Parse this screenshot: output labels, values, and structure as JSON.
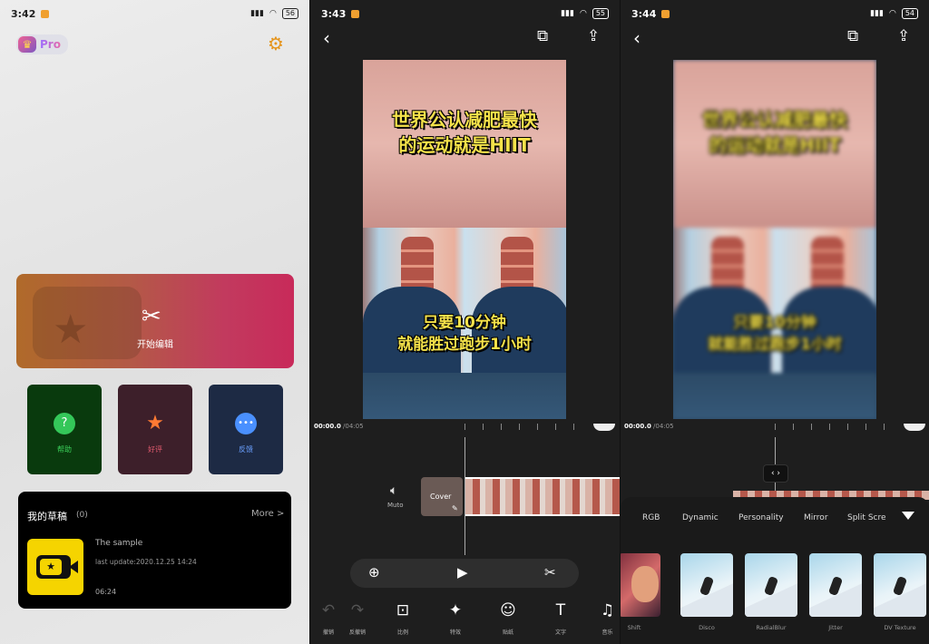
{
  "screen1": {
    "status": {
      "time": "3:42",
      "battery": "56"
    },
    "pro": "Pro",
    "start": {
      "label": "开始编辑"
    },
    "tiles": [
      {
        "label": "帮助",
        "icon": "question-icon"
      },
      {
        "label": "好评",
        "icon": "star-face-icon"
      },
      {
        "label": "反馈",
        "icon": "chat-bubble-icon"
      }
    ],
    "drafts": {
      "title": "我的草稿",
      "count": "(0)",
      "more": "More >",
      "item": {
        "name": "The sample",
        "update": "last update:2020.12.25 14:24",
        "duration": "06:24"
      }
    }
  },
  "screen2": {
    "status": {
      "time": "3:43",
      "battery": "55"
    },
    "video": {
      "line1": "世界公认减肥最快",
      "line2": "的运动就是HIIT",
      "line3": "只要10分钟",
      "line4": "就能胜过跑步1小时"
    },
    "timeline": {
      "current": "00:00.0",
      "total": "/04:05"
    },
    "mute": "Muto",
    "cover": "Cover",
    "tools": [
      {
        "label": "撤销",
        "icon": "undo-icon"
      },
      {
        "label": "反撤销",
        "icon": "redo-icon"
      },
      {
        "label": "比例",
        "icon": "ratio-icon"
      },
      {
        "label": "特效",
        "icon": "sparkle-icon"
      },
      {
        "label": "贴纸",
        "icon": "smiley-icon"
      },
      {
        "label": "文字",
        "icon": "text-icon"
      },
      {
        "label": "音乐",
        "icon": "music-icon"
      }
    ]
  },
  "screen3": {
    "status": {
      "time": "3:44",
      "battery": "54"
    },
    "timeline": {
      "current": "00:00.0",
      "total": "/04:05"
    },
    "tabs": [
      "RGB",
      "Dynamic",
      "Personality",
      "Mirror",
      "Split Scre"
    ],
    "filters": [
      "Shift",
      "Disco",
      "RadialBlur",
      "Jitter",
      "DV Texture"
    ]
  }
}
